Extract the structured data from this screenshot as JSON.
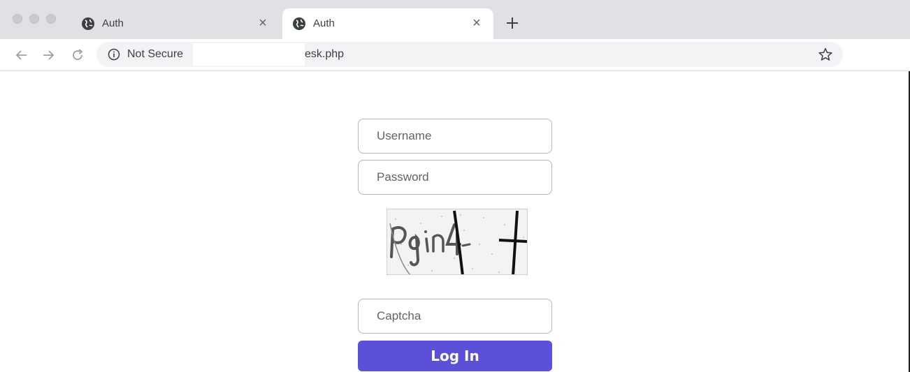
{
  "browser": {
    "tabs": [
      {
        "title": "Auth",
        "icon": "globe-icon",
        "active": false
      },
      {
        "title": "Auth",
        "icon": "globe-icon",
        "active": true
      }
    ],
    "tab_close_glyph": "×",
    "address_bar": {
      "security_label": "Not Secure",
      "url_visible": "esk.php"
    }
  },
  "form": {
    "username_placeholder": "Username",
    "password_placeholder": "Password",
    "captcha_image_text": "Pgin4-",
    "captcha_placeholder": "Captcha",
    "login_label": "Log In"
  },
  "colors": {
    "accent": "#5b51d8",
    "tabstrip": "#dfe1e5",
    "omnibox": "#f1f3f4"
  }
}
